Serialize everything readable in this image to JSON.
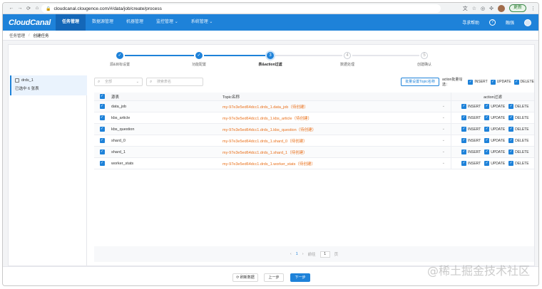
{
  "browser": {
    "url": "cloudcanal.clougence.com/#/data/job/create/process",
    "update_label": "更新"
  },
  "app": {
    "logo": "CloudCanal",
    "menu": [
      {
        "label": "任务管理",
        "active": true
      },
      {
        "label": "数据源管理",
        "active": false
      },
      {
        "label": "机器管理",
        "active": false
      },
      {
        "label": "监控管理 ⌄",
        "active": false
      },
      {
        "label": "系统管理 ⌄",
        "active": false
      }
    ],
    "right_links": {
      "help": "寻求帮助",
      "user": "融强"
    }
  },
  "breadcrumb": [
    "任务管理",
    "创建任务"
  ],
  "steps": [
    {
      "label": "源&目标设置",
      "state": "done",
      "marker": "✓"
    },
    {
      "label": "功能配置",
      "state": "done",
      "marker": "✓"
    },
    {
      "label": "表&action过滤",
      "state": "current",
      "marker": "3"
    },
    {
      "label": "数据处理",
      "state": "todo",
      "marker": "4"
    },
    {
      "label": "创建确认",
      "state": "todo",
      "marker": "5"
    }
  ],
  "left_panel": {
    "db_name": "drds_1",
    "selected_text": "已选中 6 张表"
  },
  "filters": {
    "select_placeholder": "全部",
    "search_placeholder": "搜索表名",
    "batch_button": "批量设置Topic名称",
    "action_batch_label": "action批量勾选：",
    "actions": [
      "INSERT",
      "UPDATE",
      "DELETE"
    ]
  },
  "table": {
    "headers": {
      "name": "源表",
      "topic": "Topic名称",
      "action": "action过滤"
    },
    "rows": [
      {
        "name": "data_job",
        "topic": "my-97e3e5ed64dcc1.drds_1.data_job（待创建）"
      },
      {
        "name": "kbs_article",
        "topic": "my-97e3e5ed64dcc1.drds_1.kbs_article（待创建）"
      },
      {
        "name": "kbs_question",
        "topic": "my-97e3e5ed64dcc1.drds_1.kbs_question（待创建）"
      },
      {
        "name": "shard_0",
        "topic": "my-97e3e5ed64dcc1.drds_1.shard_0（待创建）"
      },
      {
        "name": "shard_1",
        "topic": "my-97e3e5ed64dcc1.drds_1.shard_1（待创建）"
      },
      {
        "name": "worker_stats",
        "topic": "my-97e3e5ed64dcc1.drds_1.worker_stats（待创建）"
      }
    ],
    "row_actions": [
      "INSERT",
      "UPDATE",
      "DELETE"
    ]
  },
  "pagination": {
    "prev": "‹",
    "page": "1",
    "next": "›",
    "goto": "前往",
    "input": "1",
    "unit": "页"
  },
  "footer": {
    "refresh": "⟳ 刷新数据",
    "prev": "上一步",
    "next": "下一步"
  },
  "watermark": "@稀土掘金技术社区"
}
